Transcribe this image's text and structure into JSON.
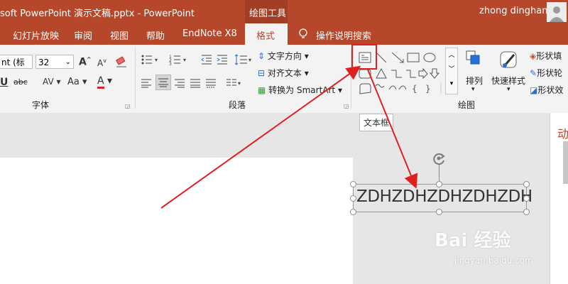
{
  "titlebar": {
    "doc_title": "soft PowerPoint  演示文稿.pptx  -  PowerPoint",
    "context_title": "绘图工具",
    "user_name": "zhong dinghan",
    "accent": "#b7472a"
  },
  "tabs": [
    {
      "label": "幻灯片放映"
    },
    {
      "label": "审阅"
    },
    {
      "label": "视图"
    },
    {
      "label": "帮助"
    },
    {
      "label": "EndNote X8"
    },
    {
      "label": "格式"
    },
    {
      "label": "操作说明搜索"
    }
  ],
  "font_group": {
    "font_name": "nt (标",
    "font_size": "32",
    "grow_label": "A",
    "shrink_label": "A",
    "underline_label": "U",
    "strike_label": "abc",
    "spacing_label": "AV",
    "case_label": "Aa",
    "color_label": "A",
    "group_label": "字体"
  },
  "paragraph_group": {
    "text_direction": "文字方向",
    "align_text": "对齐文本",
    "convert_smartart": "转换为 SmartArt",
    "group_label": "段落"
  },
  "drawing_group": {
    "arrange": "排列",
    "quick_styles": "快速样式",
    "shape_fill": "形状填",
    "shape_outline": "形状轮",
    "shape_effects": "形状效",
    "group_label": "绘图"
  },
  "tooltip": "文本框",
  "textbox": {
    "content": "ZDHZDHZDHZDHZDH"
  },
  "right_pane": {
    "label": "动"
  },
  "watermark": {
    "text": "Bai 经验",
    "url": "jingyan.baidu.com"
  },
  "annotation_color": "#e02020"
}
